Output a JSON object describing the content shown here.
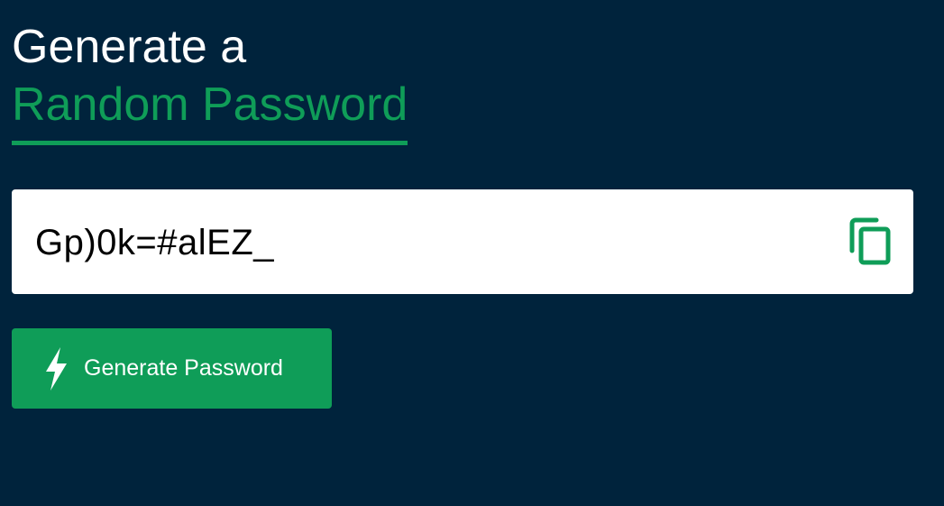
{
  "heading": {
    "line1": "Generate a",
    "line2": "Random Password"
  },
  "password": {
    "value": "Gp)0k=#alEZ_"
  },
  "copy_button": {
    "icon": "copy-icon"
  },
  "generate_button": {
    "label": "Generate Password",
    "icon": "bolt-icon"
  },
  "colors": {
    "background": "#00233c",
    "accent": "#0f9d58",
    "text_light": "#ffffff",
    "input_bg": "#ffffff"
  }
}
